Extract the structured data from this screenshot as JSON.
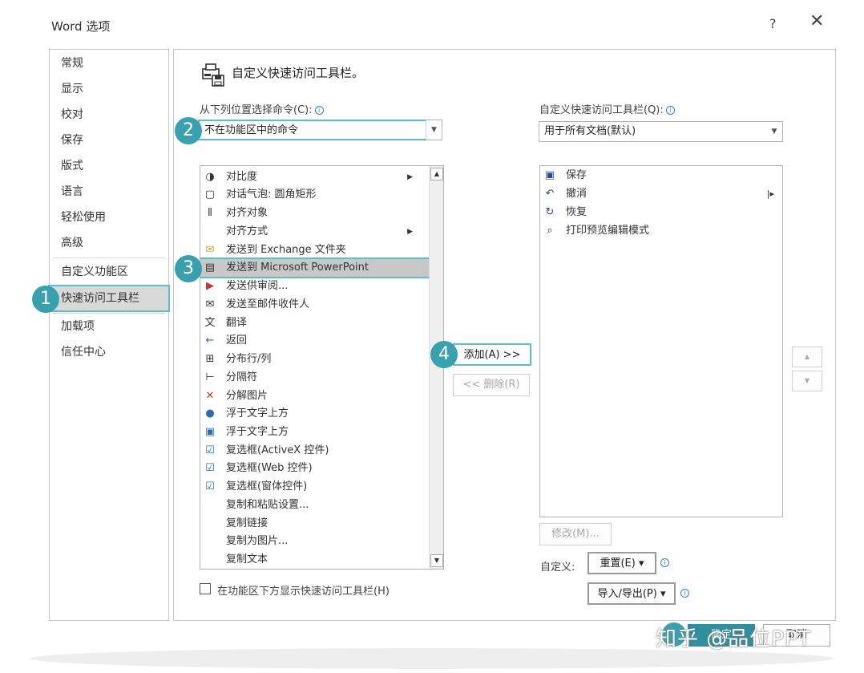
{
  "dialog": {
    "title": "Word 选项",
    "help": "?",
    "close": "✕"
  },
  "sidebar": {
    "items": [
      {
        "label": "常规"
      },
      {
        "label": "显示"
      },
      {
        "label": "校对"
      },
      {
        "label": "保存"
      },
      {
        "label": "版式"
      },
      {
        "label": "语言"
      },
      {
        "label": "轻松使用"
      },
      {
        "label": "高级"
      },
      {
        "label": "自定义功能区"
      },
      {
        "label": "快速访问工具栏"
      },
      {
        "label": "加载项"
      },
      {
        "label": "信任中心"
      }
    ]
  },
  "main": {
    "heading": "自定义快速访问工具栏。",
    "choose_label": "从下列位置选择命令(C):",
    "choose_value": "不在功能区中的命令",
    "customize_label": "自定义快速访问工具栏(Q):",
    "customize_value": "用于所有文档(默认)",
    "info_glyph": "ⓘ",
    "commands": [
      {
        "label": "对比度",
        "icon": "◑"
      },
      {
        "label": "对话气泡: 圆角矩形",
        "icon": "▢"
      },
      {
        "label": "对齐对象",
        "icon": "⫴"
      },
      {
        "label": "对齐方式",
        "icon": ""
      },
      {
        "label": "发送到 Exchange 文件夹",
        "icon": "✉"
      },
      {
        "label": "发送到 Microsoft PowerPoint",
        "icon": "▤"
      },
      {
        "label": "发送供审阅...",
        "icon": "▶"
      },
      {
        "label": "发送至邮件收件人",
        "icon": "✉"
      },
      {
        "label": "翻译",
        "icon": "文"
      },
      {
        "label": "返回",
        "icon": "←"
      },
      {
        "label": "分布行/列",
        "icon": "⊞"
      },
      {
        "label": "分隔符",
        "icon": "⊢"
      },
      {
        "label": "分解图片",
        "icon": "✕"
      },
      {
        "label": "浮于文字上方",
        "icon": "●"
      },
      {
        "label": "浮于文字上方",
        "icon": "▣"
      },
      {
        "label": "复选框(ActiveX 控件)",
        "icon": "☑"
      },
      {
        "label": "复选框(Web 控件)",
        "icon": "☑"
      },
      {
        "label": "复选框(窗体控件)",
        "icon": "☑"
      },
      {
        "label": "复制和粘贴设置...",
        "icon": ""
      },
      {
        "label": "复制链接",
        "icon": ""
      },
      {
        "label": "复制为图片...",
        "icon": ""
      },
      {
        "label": "复制文本",
        "icon": ""
      }
    ],
    "qat_items": [
      {
        "label": "保存",
        "icon": "💾"
      },
      {
        "label": "撤消",
        "icon": "↶"
      },
      {
        "label": "恢复",
        "icon": "↻"
      },
      {
        "label": "打印预览编辑模式",
        "icon": "🔍"
      }
    ],
    "add_label": "添加(A) >>",
    "remove_label": "<< 删除(R)",
    "modify_label": "修改(M)...",
    "customize_text": "自定义:",
    "reset_label": "重置(E) ▾",
    "import_export_label": "导入/导出(P) ▾",
    "show_below_label": "在功能区下方显示快速访问工具栏(H)",
    "ok_label": "确定",
    "cancel_label": "取消"
  },
  "badges": [
    "1",
    "2",
    "3",
    "4"
  ],
  "watermark": "知乎 @品位PPT"
}
